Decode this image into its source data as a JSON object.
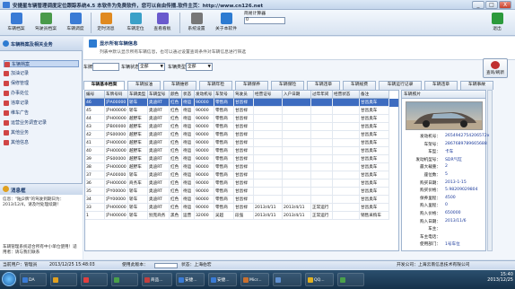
{
  "window": {
    "title": "安捷星车辆管理调度定位跟踪系统4.5 本软件为免费软件，您可以自由传播.软件主页：http://www.cn126.net",
    "btn_min": "_",
    "btn_max": "□",
    "btn_close": "X"
  },
  "toolbar": {
    "items": [
      {
        "label": "车辆档案",
        "color": "#3a7bd5"
      },
      {
        "label": "驾驶员档案",
        "color": "#4a9a4a"
      },
      {
        "label": "车辆调度",
        "color": "#3a7bd5"
      },
      {
        "label": "定时消息",
        "color": "#e08a20"
      },
      {
        "label": "车辆定位",
        "color": "#3aa0c8"
      },
      {
        "label": "查看看板",
        "color": "#6a5acd"
      },
      {
        "label": "系统设置",
        "color": "#777777"
      },
      {
        "label": "关于本软件",
        "color": "#2d7bd1"
      }
    ],
    "exit_label": "退出"
  },
  "clock": {
    "label": "简易计算器",
    "value": "0"
  },
  "left_panel": {
    "title": "车辆档案及相关业务",
    "items": [
      "车辆档案",
      "加油记录",
      "保修管理",
      "办事处位",
      "违章记录",
      "维车广告",
      "运营业务调查记录",
      "其他业务",
      "其他信息"
    ],
    "selected_index": 0
  },
  "message": {
    "title": "消息框",
    "text": "信息：\"陆J2牌\"的驾驶到期日为：2013/12/4，请及时处理续期！",
    "bottom": "车辆管理系统适合所有中小单位使用！适用者：请与我们联系"
  },
  "main": {
    "header_title": "显示所有车辆信息",
    "header_desc": "列表中默认显示所有车辆信息，也可以通过设置查询条件对车辆信息进行筛选",
    "filter": {
      "plate_label": "车牌",
      "plate_value": "",
      "status_label": "车辆状态",
      "status_value": "全部",
      "type_label": "车辆类型",
      "type_value": "全部"
    },
    "search_label": "查询/刷新",
    "tabs": [
      "车辆基本档案",
      "车辆加油",
      "车辆维修",
      "车辆年检",
      "车辆保养",
      "车辆保险",
      "车辆违章",
      "车辆规费",
      "车辆运行记录",
      "车辆违章",
      "车辆事故"
    ],
    "columns": [
      "编号",
      "车牌号码",
      "车辆类型",
      "车辆型号",
      "颜色",
      "状态",
      "发动机号",
      "车架号",
      "驾驶员",
      "经营证号",
      "入户日期",
      "过年年间",
      "经营状态",
      "备注"
    ],
    "rows": [
      [
        "46",
        "沪A00000",
        "轿车",
        "奥迪RT",
        "红色",
        "待运",
        "90000",
        "零售商",
        "甘昌禄",
        "",
        "",
        "",
        "",
        "甘昌奥车"
      ],
      [
        "45",
        "沪H00000",
        "轿车",
        "奥迪RT",
        "红色",
        "待运",
        "90000",
        "零售商",
        "甘昌禄",
        "",
        "",
        "",
        "",
        "甘昌奥车"
      ],
      [
        "44",
        "沪H00000",
        "越野车",
        "奥迪RT",
        "红色",
        "待运",
        "90000",
        "零售商",
        "甘昌禄",
        "",
        "",
        "",
        "",
        "甘昌奥车"
      ],
      [
        "43",
        "沪B00000",
        "越野车",
        "奥迪RT",
        "红色",
        "待运",
        "90000",
        "零售商",
        "甘昌禄",
        "",
        "",
        "",
        "",
        "甘昌奥车"
      ],
      [
        "42",
        "沪S00000",
        "越野车",
        "奥迪RT",
        "红色",
        "待运",
        "90000",
        "零售商",
        "甘昌禄",
        "",
        "",
        "",
        "",
        "甘昌奥车"
      ],
      [
        "41",
        "沪H00000",
        "越野车",
        "奥迪RT",
        "红色",
        "待运",
        "90000",
        "零售商",
        "甘昌禄",
        "",
        "",
        "",
        "",
        "甘昌奥车"
      ],
      [
        "40",
        "沪H00000",
        "越野车",
        "奥迪RT",
        "红色",
        "待运",
        "90000",
        "零售商",
        "甘昌禄",
        "",
        "",
        "",
        "",
        "甘昌奥车"
      ],
      [
        "39",
        "沪S00000",
        "越野车",
        "奥迪RT",
        "红色",
        "待运",
        "90000",
        "零售商",
        "甘昌禄",
        "",
        "",
        "",
        "",
        "甘昌奥车"
      ],
      [
        "38",
        "沪H00000",
        "越野车",
        "奥迪RT",
        "红色",
        "待运",
        "90000",
        "零售商",
        "甘昌禄",
        "",
        "",
        "",
        "",
        "甘昌奥车"
      ],
      [
        "37",
        "沪A00000",
        "轿车",
        "奥迪RT",
        "红色",
        "待运",
        "90000",
        "零售商",
        "甘昌禄",
        "",
        "",
        "",
        "",
        "甘昌奥车"
      ],
      [
        "36",
        "沪H00000",
        "商务车",
        "奥迪RT",
        "红色",
        "待运",
        "90000",
        "零售商",
        "甘昌禄",
        "",
        "",
        "",
        "",
        "甘昌奥车"
      ],
      [
        "35",
        "沪Y00000",
        "轿车",
        "奥迪RT",
        "红色",
        "待运",
        "90000",
        "零售商",
        "甘昌禄",
        "",
        "",
        "",
        "",
        "甘昌奥车"
      ],
      [
        "34",
        "沪Y00000",
        "轿车",
        "奥迪RT",
        "红色",
        "待运",
        "90000",
        "零售商",
        "甘昌禄",
        "",
        "",
        "",
        "",
        "甘昌奥车"
      ],
      [
        "33",
        "沪H00000",
        "轿车",
        "奥迪RT",
        "红色",
        "待运",
        "90000",
        "零售商",
        "甘昌禄",
        "2013/4/11",
        "2013/4/11",
        "正常运行",
        "",
        "甘昌奥车"
      ],
      [
        "1",
        "沪H00000",
        "轿车",
        "别克商务",
        "黑色",
        "运营",
        "32000",
        "吴超",
        "段强",
        "2013/4/11",
        "2013/4/11",
        "正常运行",
        "",
        "销售采购车"
      ]
    ],
    "selected_row": 0
  },
  "detail": {
    "title": "车辆照片",
    "fields": [
      {
        "label": "发动机号：",
        "value": "2654942754206572x"
      },
      {
        "label": "车架号：",
        "value": "2867689789665688"
      },
      {
        "label": "车型：",
        "value": "卡车"
      },
      {
        "label": "发动机型号：",
        "value": "SDR气缸"
      },
      {
        "label": "最大载重：",
        "value": "2"
      },
      {
        "label": "座位数：",
        "value": "5"
      },
      {
        "label": "购买日期：",
        "value": "2013-1-15"
      },
      {
        "label": "购买价格：",
        "value": "5.98209029804"
      },
      {
        "label": "保养里程：",
        "value": "4500"
      },
      {
        "label": "购入里程：",
        "value": "0"
      },
      {
        "label": "购入价格：",
        "value": "650000"
      },
      {
        "label": "购入日期：",
        "value": "2013/11/6"
      },
      {
        "label": "车主：",
        "value": ""
      },
      {
        "label": "车主电话：",
        "value": ""
      },
      {
        "label": "使用部门：",
        "value": "1号车位"
      }
    ]
  },
  "statusbar": {
    "user_label": "当前用户：管理员",
    "datetime": "2013/12/25 15:48:03",
    "tip_label": "使用此版本：",
    "status_text": "状态：上海伯宏",
    "company": "开发公司：上海云南信息技术有限公司"
  },
  "taskbar": {
    "items": [
      {
        "label": "DA",
        "color": "#3a7bd5"
      },
      {
        "label": "",
        "color": "#e0a020"
      },
      {
        "label": "",
        "color": "#e04040"
      },
      {
        "label": "",
        "color": "#4aa04a"
      },
      {
        "label": "商品...",
        "color": "#c04040"
      },
      {
        "label": "安捷...",
        "color": "#3a7bd5"
      },
      {
        "label": "安捷...",
        "color": "#3a7bd5"
      },
      {
        "label": "Micr...",
        "color": "#c87030"
      },
      {
        "label": "",
        "color": "#6090d0"
      },
      {
        "label": "QQ...",
        "color": "#e0b020"
      },
      {
        "label": "",
        "color": "#4aa04a"
      }
    ],
    "tray_time": "15:40",
    "tray_date": "2013/12/25"
  },
  "colors": {
    "accent": "#3d6cc0",
    "brand": "#2d7bd1"
  }
}
